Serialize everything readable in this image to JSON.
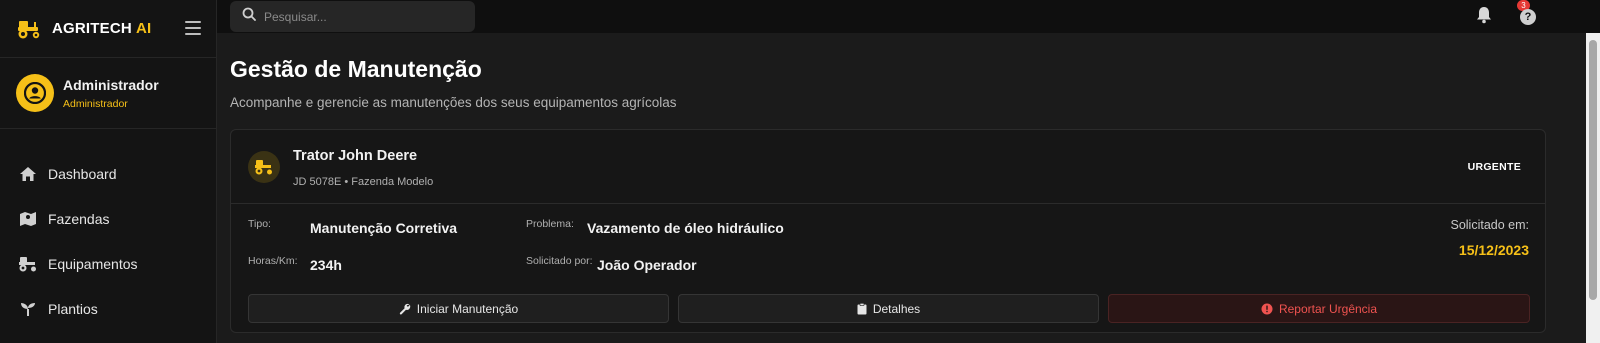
{
  "brand": {
    "name": "AGRITECH",
    "accent": "AI",
    "accent_color": "#f6c018",
    "logo_icon": "tractor-icon"
  },
  "user": {
    "name": "Administrador",
    "role": "Administrador",
    "avatar_icon": "user-circle-icon"
  },
  "sidebar": {
    "items": [
      {
        "label": "Dashboard",
        "icon": "home-icon"
      },
      {
        "label": "Fazendas",
        "icon": "map-icon"
      },
      {
        "label": "Equipamentos",
        "icon": "tractor-icon"
      },
      {
        "label": "Plantios",
        "icon": "sprout-icon"
      }
    ]
  },
  "topbar": {
    "search_placeholder": "Pesquisar...",
    "notification_count": "3",
    "help_label": "?"
  },
  "page": {
    "title": "Gestão de Manutenção",
    "subtitle": "Acompanhe e gerencie as manutenções dos seus equipamentos agrícolas"
  },
  "card": {
    "equipment_name": "Trator John Deere",
    "equipment_meta": "JD 5078E • Fazenda Modelo",
    "priority": "URGENTE",
    "fields": {
      "tipo_label": "Tipo:",
      "tipo_value": "Manutenção Corretiva",
      "problema_label": "Problema:",
      "problema_value": "Vazamento de óleo hidráulico",
      "horas_label": "Horas/Km:",
      "horas_value": "234h",
      "solicitado_por_label": "Solicitado por:",
      "solicitado_por_value": "João Operador",
      "solicitado_em_label": "Solicitado em:",
      "solicitado_em_value": "15/12/2023"
    },
    "buttons": {
      "start": "Iniciar Manutenção",
      "details": "Detalhes",
      "report": "Reportar Urgência"
    }
  },
  "colors": {
    "accent": "#f6c018",
    "danger": "#ef5350",
    "background": "#1b1b1b"
  }
}
